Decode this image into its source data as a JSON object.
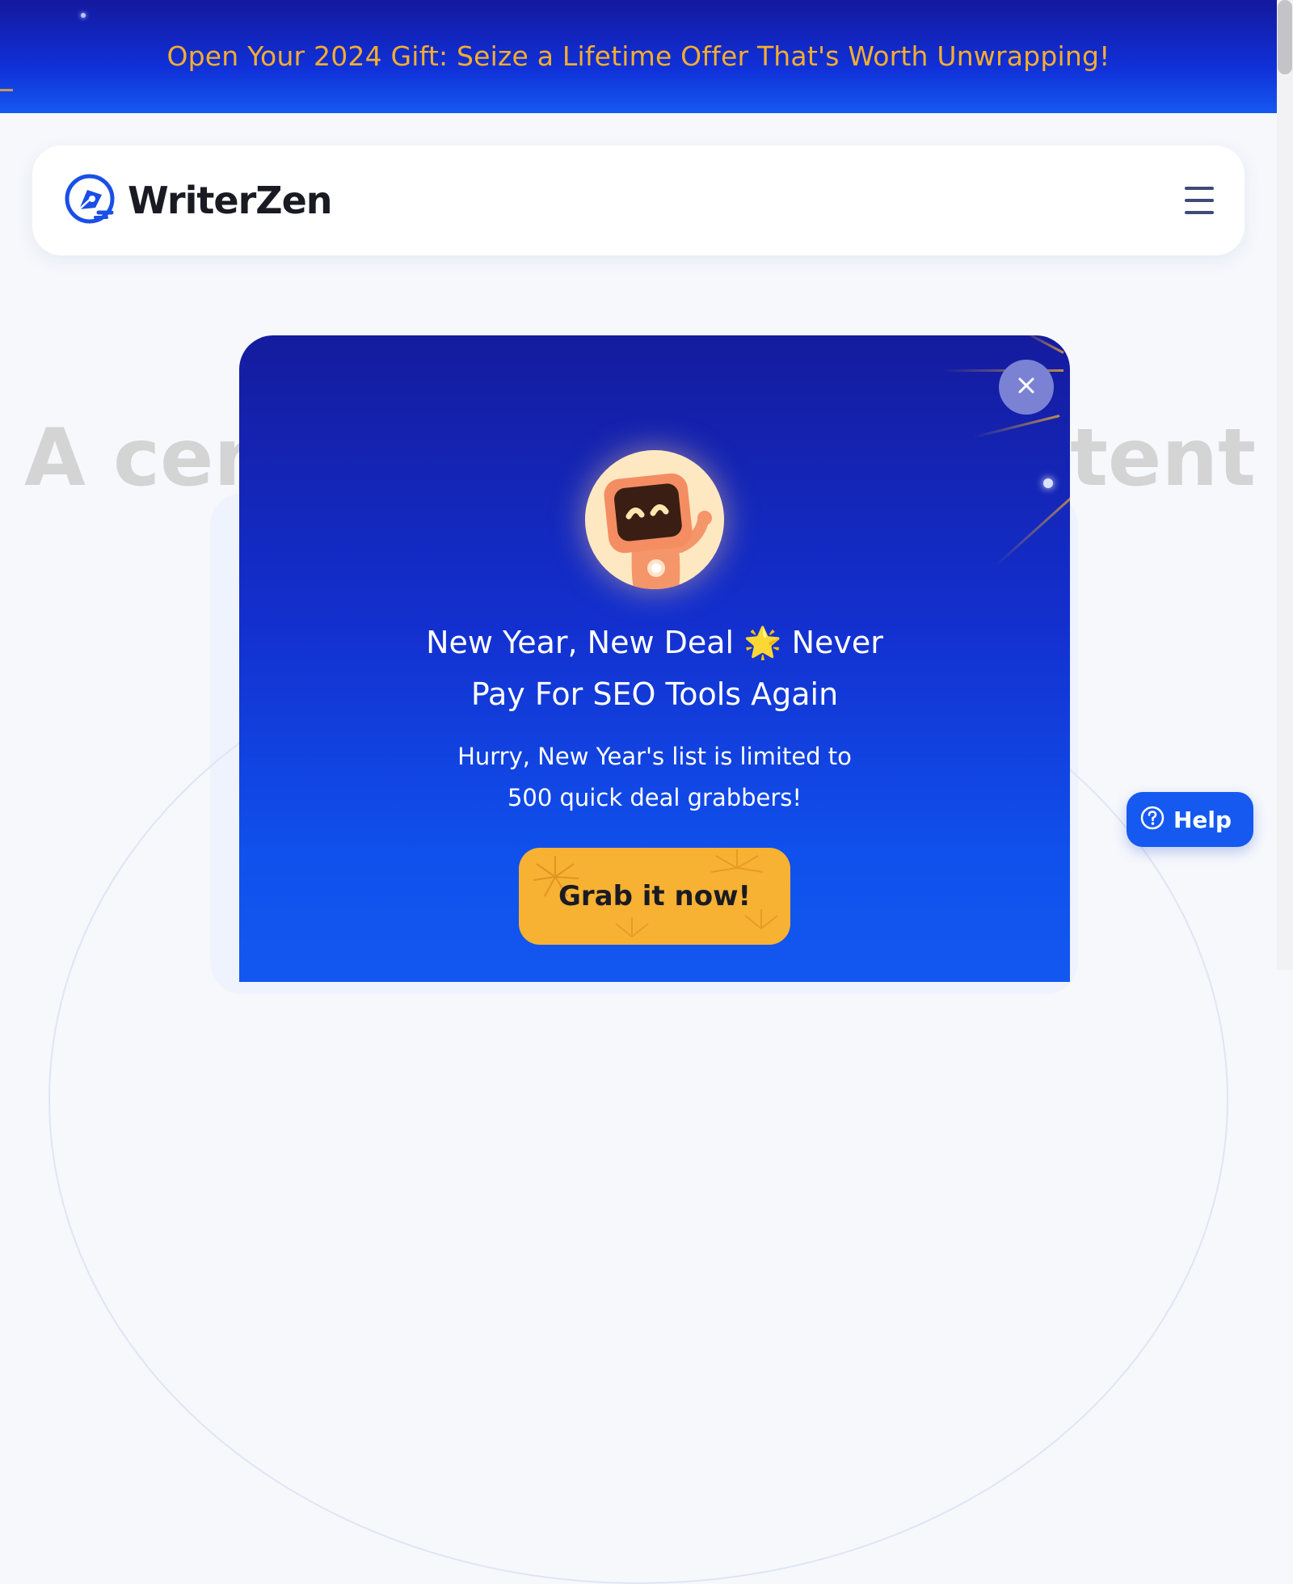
{
  "promo_banner": {
    "text": "Open Your 2024 Gift: Seize a Lifetime Offer That's Worth Unwrapping!"
  },
  "navbar": {
    "brand_name": "WriterZen",
    "logo_icon": "pen-nib-logo-icon",
    "menu_icon": "hamburger-menu-icon"
  },
  "hero": {
    "headline_left": "A cen",
    "headline_right": "ntent"
  },
  "modal": {
    "title_line_1": "New Year, New Deal 🌟 Never",
    "title_line_2": "Pay For SEO Tools Again",
    "subtitle_line_1": "Hurry, New Year's list is limited to",
    "subtitle_line_2": "500 quick deal grabbers!",
    "cta_label": "Grab it now!",
    "close_icon": "close-icon",
    "mascot_icon": "robot-mascot-icon"
  },
  "help_widget": {
    "label": "Help",
    "icon": "question-circle-icon"
  },
  "colors": {
    "banner_text": "#f6ad2f",
    "brand_blue": "#1559f0",
    "modal_top": "#141b9e",
    "cta_bg": "#f7b133"
  }
}
